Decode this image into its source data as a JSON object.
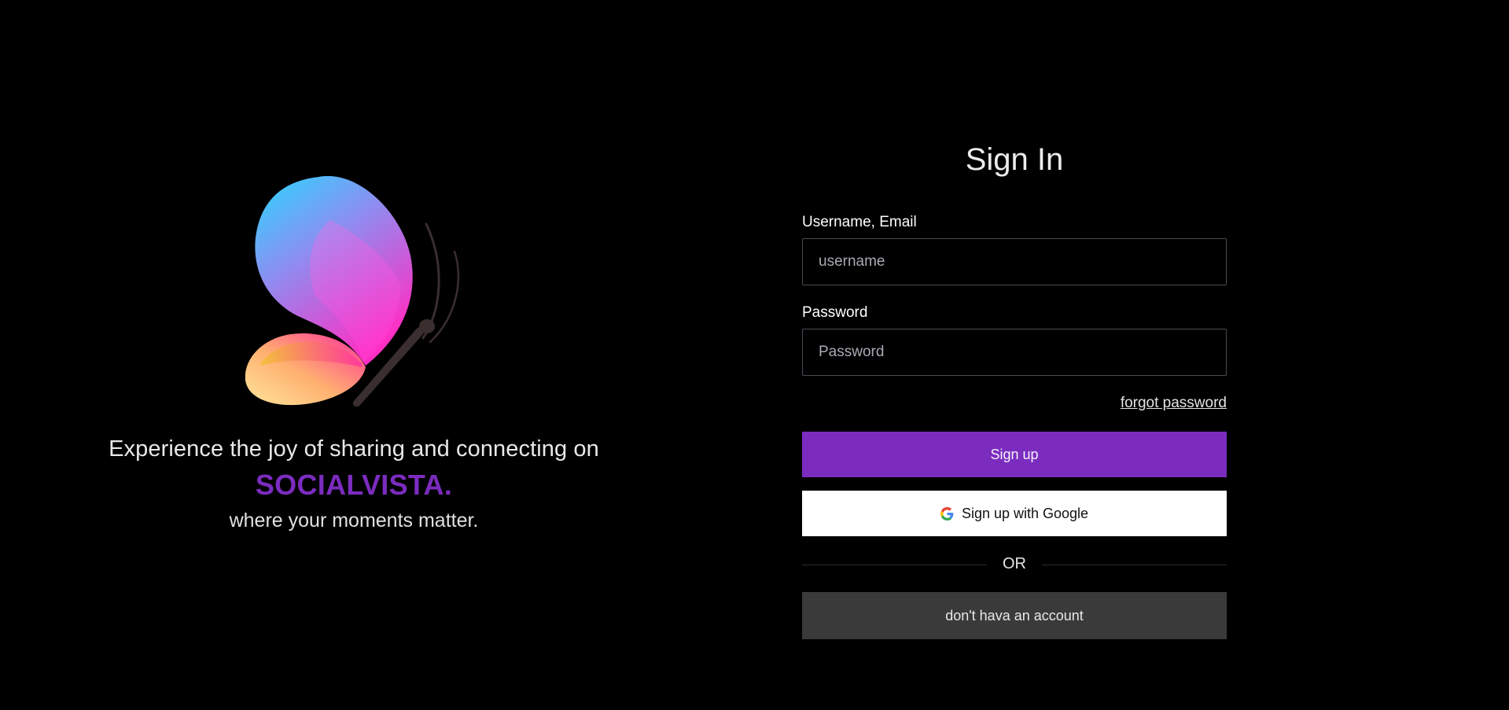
{
  "brand": {
    "logo_icon": "butterfly-icon",
    "tagline": "Experience the joy of sharing and connecting on",
    "name": "SOCIALVISTA.",
    "subline": "where your moments matter.",
    "accent_color": "#7b2cbf"
  },
  "form": {
    "title": "Sign In",
    "username_label": "Username, Email",
    "username_placeholder": "username",
    "username_value": "",
    "password_label": "Password",
    "password_placeholder": "Password",
    "password_value": "",
    "forgot_label": "forgot password",
    "signup_label": "Sign up",
    "google_label": "Sign up with Google",
    "google_icon": "google-icon",
    "divider_label": "OR",
    "no_account_label": "don't hava an account"
  },
  "colors": {
    "background": "#000000",
    "primary_button": "#7b2cbf",
    "google_button": "#ffffff",
    "secondary_button": "#3a3a3a"
  }
}
